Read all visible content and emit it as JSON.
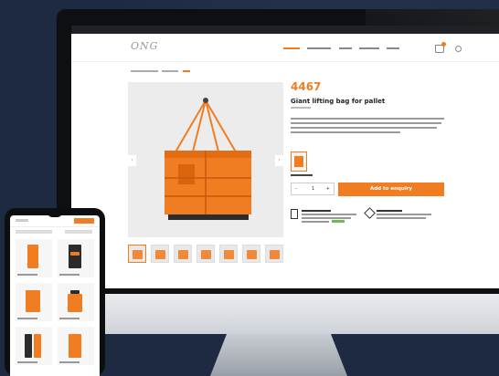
{
  "colors": {
    "accent": "#f07d22",
    "background": "#1d2a42"
  },
  "product": {
    "code": "4467",
    "title": "Giant lifting bag for pallet",
    "add_label": "Add to enquiry",
    "quantity": "1",
    "minus": "-",
    "plus": "+"
  },
  "icons": {
    "cart": "cart-icon",
    "search": "search-icon",
    "prev": "chevron-left-icon",
    "next": "chevron-right-icon"
  },
  "gallery": {
    "prev_glyph": "‹",
    "next_glyph": "›"
  }
}
